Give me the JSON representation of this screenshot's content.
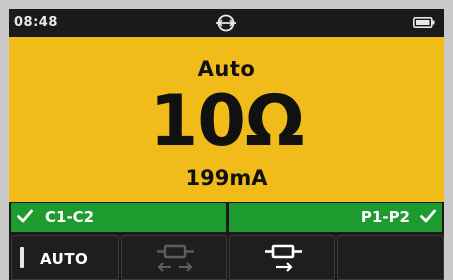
{
  "status_bar": {
    "time": "08:48",
    "center_icon": "probe-connection-icon",
    "battery_icon": "battery-icon"
  },
  "display": {
    "mode": "Auto",
    "reading": "10Ω",
    "sub_reading": "199mA",
    "background_color": "#f1bc1a"
  },
  "leads": {
    "left": {
      "label": "C1-C2",
      "icon": "check-icon",
      "status_color": "#1d9b2f"
    },
    "right": {
      "label": "P1-P2",
      "icon": "check-icon",
      "status_color": "#1d9b2f"
    }
  },
  "softkeys": [
    {
      "label": "AUTO",
      "icon": "indicator-bar",
      "enabled": true
    },
    {
      "label": "",
      "icon": "bidirectional-current-icon",
      "enabled": false
    },
    {
      "label": "",
      "icon": "forward-current-icon",
      "enabled": true
    },
    {
      "label": "",
      "icon": "",
      "enabled": false
    }
  ]
}
